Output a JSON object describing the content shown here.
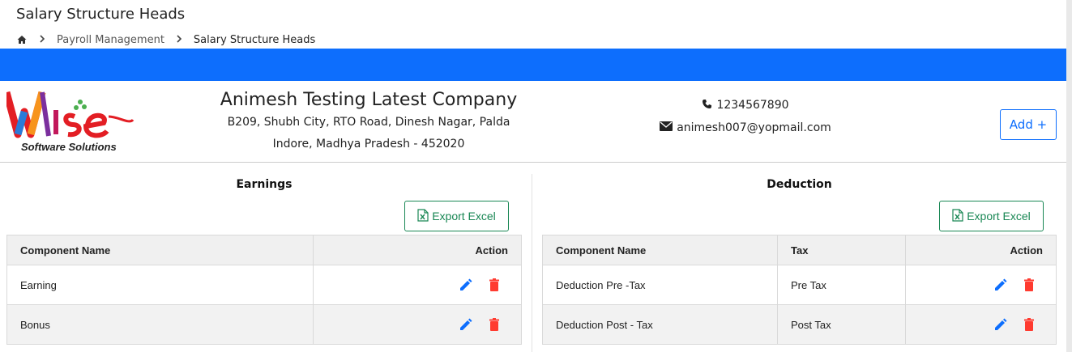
{
  "page": {
    "title": "Salary Structure Heads"
  },
  "breadcrumb": {
    "home_icon": "home-icon",
    "parent": "Payroll Management",
    "current": "Salary Structure Heads"
  },
  "company": {
    "logo_icon": "wise-logo",
    "logo_tagline": "Software Solutions",
    "name": "Animesh Testing Latest Company",
    "address_line1": "B209, Shubh City, RTO Road, Dinesh Nagar, Palda",
    "address_line2": "Indore, Madhya Pradesh - 452020",
    "phone": "1234567890",
    "email": "animesh007@yopmail.com"
  },
  "toolbar": {
    "add_label": "Add +"
  },
  "colors": {
    "primary": "#0d6efd",
    "success": "#198754",
    "danger": "#dc3545"
  },
  "earnings": {
    "title": "Earnings",
    "export_label": "Export Excel",
    "headers": {
      "component": "Component Name",
      "action": "Action"
    },
    "rows": [
      {
        "component": "Earning"
      },
      {
        "component": "Bonus"
      }
    ]
  },
  "deduction": {
    "title": "Deduction",
    "export_label": "Export Excel",
    "headers": {
      "component": "Component Name",
      "tax": "Tax",
      "action": "Action"
    },
    "rows": [
      {
        "component": "Deduction Pre -Tax",
        "tax": "Pre Tax"
      },
      {
        "component": "Deduction Post - Tax",
        "tax": "Post Tax"
      }
    ]
  }
}
